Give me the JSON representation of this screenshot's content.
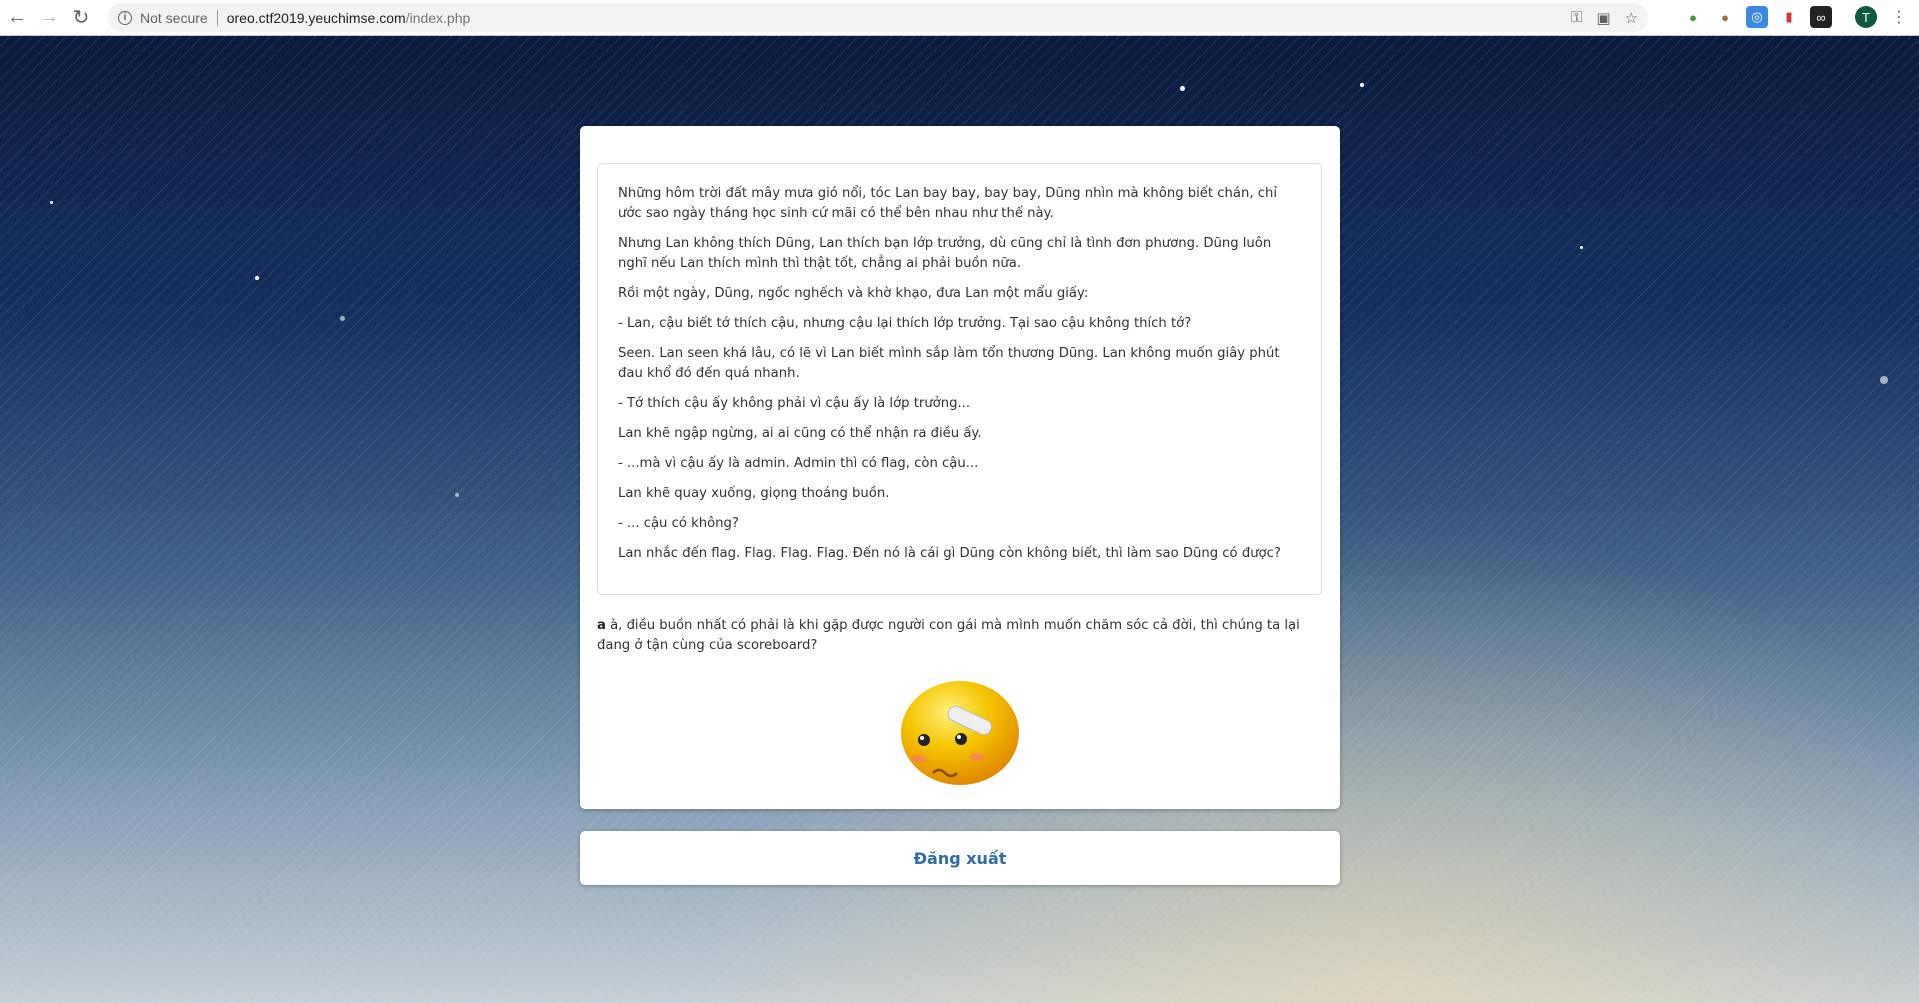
{
  "browser": {
    "security_label": "Not secure",
    "url_host": "oreo.ctf2019.yeuchimse.com",
    "url_path": "/index.php",
    "profile_initial": "T"
  },
  "story": {
    "paragraphs": [
      "Những hôm trời đất mây mưa gió nổi, tóc Lan bay bay, bay bay, Dũng nhìn mà không biết chán, chỉ ước sao ngày tháng học sinh cứ mãi có thể bên nhau như thế này.",
      "Nhưng Lan không thích Dũng, Lan thích bạn lớp trưởng, dù cũng chỉ là tình đơn phương. Dũng luôn nghĩ nếu Lan thích mình thì thật tốt, chẳng ai phải buồn nữa.",
      "Rồi một ngày, Dũng, ngốc nghếch và khờ khạo, đưa Lan một mẩu giấy:",
      "- Lan, cậu biết tớ thích cậu, nhưng cậu lại thích lớp trưởng. Tại sao cậu không thích tớ?",
      "Seen. Lan seen khá lâu, có lẽ vì Lan biết mình sắp làm tổn thương Dũng. Lan không muốn giây phút đau khổ đó đến quá nhanh.",
      "- Tớ thích cậu ấy không phải vì cậu ấy là lớp trưởng...",
      "Lan khẽ ngập ngừng, ai ai cũng có thể nhận ra điều ấy.",
      "- ...mà vì cậu ấy là admin. Admin thì có flag, còn cậu...",
      "Lan khẽ quay xuống, giọng thoáng buồn.",
      "- ... cậu có không?",
      "Lan nhắc đến flag. Flag. Flag. Flag. Đến nó là cái gì Dũng còn không biết, thì làm sao Dũng có được?"
    ]
  },
  "question": {
    "username": "a",
    "text": " à, điều buồn nhất có phải là khi gặp được người con gái mà mình muốn chăm sóc cả đời, thì chúng ta lại đang ở tận cùng của scoreboard?"
  },
  "logout_label": "Đăng xuất",
  "colors": {
    "link": "#2f6da3",
    "emoji": "#f5c400"
  }
}
